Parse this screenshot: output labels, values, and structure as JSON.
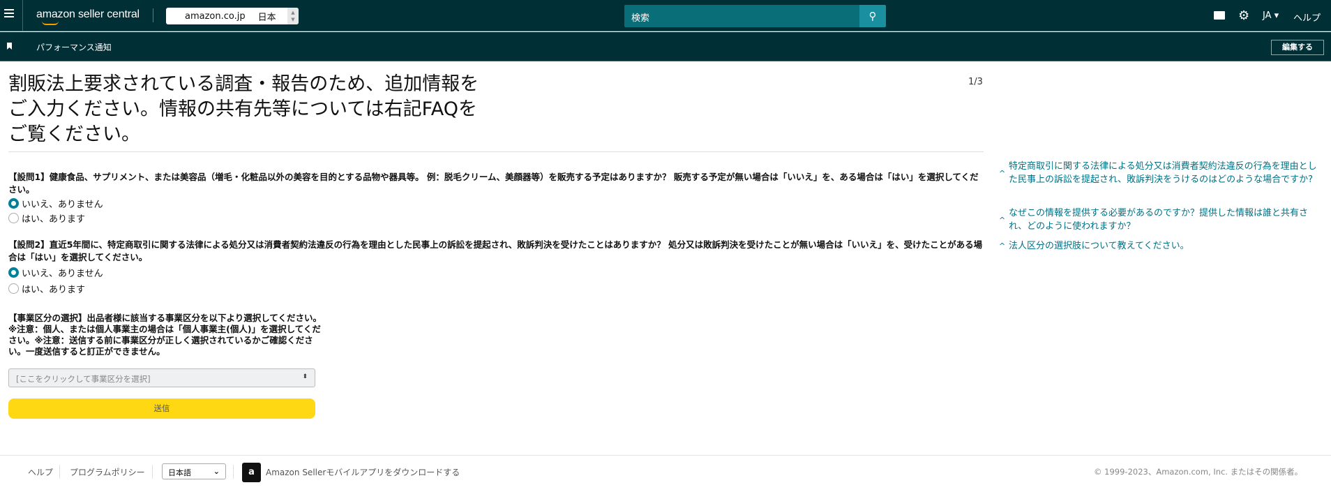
{
  "header": {
    "logo_text": "amazon seller central",
    "marketplace_domain": "amazon.co.jp",
    "marketplace_country": "日本",
    "search_placeholder": "検索",
    "language": "JA ▾",
    "help": "ヘルプ"
  },
  "subnav": {
    "title": "パフォーマンス通知",
    "edit_label": "編集する"
  },
  "main": {
    "title": "割販法上要求されている調査・報告のため、追加情報をご入力ください。情報の共有先等については右記FAQをご覧ください。",
    "page_indicator": "1/3",
    "questions": [
      {
        "text": "【設問1】健康食品、サプリメント、または美容品（増毛・化粧品以外の美容を目的とする品物や器具等。 例：脱毛クリーム、美顔器等）を販売する予定はありますか？ 販売する予定が無い場合は「いいえ」を、ある場合は「はい」を選択してください。",
        "options": [
          "いいえ、ありません",
          "はい、あります"
        ],
        "selected": 0
      },
      {
        "text": "【設問2】直近5年間に、特定商取引に関する法律による処分又は消費者契約法違反の行為を理由とした民事上の訴訟を提起され、敗訴判決を受けたことはありますか？ 処分又は敗訴判決を受けたことが無い場合は「いいえ」を、受けたことがある場合は「はい」を選択してください。",
        "options": [
          "いいえ、ありません",
          "はい、あります"
        ],
        "selected": 0
      }
    ],
    "business_type_text": "【事業区分の選択】出品者様に該当する事業区分を以下より選択してください。※注意：個人、または個人事業主の場合は「個人事業主(個人)」を選択してください。※注意：送信する前に事業区分が正しく選択されているかご確認ください。一度送信すると訂正ができません。",
    "business_type_select": "[ここをクリックして事業区分を選択]",
    "submit_label": "送信"
  },
  "faq": [
    "特定商取引に関する法律による処分又は消費者契約法違反の行為を理由とした民事上の訴訟を提起され、敗訴判決をうけるのはどのような場合ですか?",
    "なぜこの情報を提供する必要があるのですか？提供した情報は誰と共有され、どのように使われますか？",
    "法人区分の選択肢について教えてください。"
  ],
  "footer": {
    "help": "ヘルプ",
    "policy": "プログラムポリシー",
    "language": "日本語",
    "app_download": "Amazon Sellerモバイルアプリをダウンロードする",
    "copyright": "© 1999-2023、Amazon.com, Inc. またはその関係者。"
  },
  "colors": {
    "header_bg": "#002f36",
    "accent": "#008296",
    "link": "#007185",
    "submit": "#ffd814"
  }
}
